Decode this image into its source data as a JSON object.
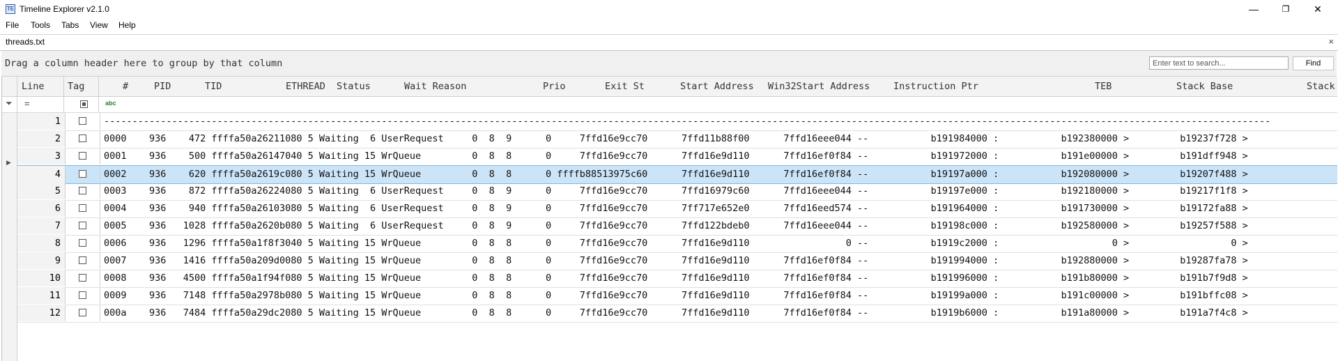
{
  "window": {
    "title": "Timeline Explorer v2.1.0",
    "icon": "app-icon",
    "icon_glyph": "TE"
  },
  "window_controls": {
    "minimize": "—",
    "maximize": "❐",
    "close": "✕"
  },
  "menu": [
    "File",
    "Tools",
    "Tabs",
    "View",
    "Help"
  ],
  "document_tab": {
    "label": "threads.txt",
    "close": "×"
  },
  "group_hint": "Drag a column header here to group by that column",
  "search": {
    "placeholder": "Enter text to search...",
    "value": "",
    "find_label": "Find"
  },
  "columns": [
    "Line",
    "Tag",
    "#",
    "PID",
    "TID",
    "ETHREAD",
    "Status",
    "Wait Reason",
    "Prio",
    "Exit St",
    "Start Address",
    "Win32Start Address",
    "Instruction Ptr",
    "TEB",
    "Stack Base",
    "Stack"
  ],
  "filter_row": {
    "filter_icon": "filter-icon",
    "equals": "=",
    "text_filter": "abc"
  },
  "rows": [
    {
      "line": "1",
      "text": "--------------------------------------------------------------------------------------------------------------------------------------------------------------------------------------------------------------"
    },
    {
      "line": "2",
      "text": "0000    936    472 ffffa50a26211080 5 Waiting  6 UserRequest     0  8  9      0     7ffd16e9cc70      7ffd11b88f00      7ffd16eee044 --           b191984000 :           b192380000 >         b19237f728 >"
    },
    {
      "line": "3",
      "text": "0001    936    500 ffffa50a26147040 5 Waiting 15 WrQueue         0  8  8      0     7ffd16e9cc70      7ffd16e9d110      7ffd16ef0f84 --           b191972000 :           b191e00000 >         b191dff948 >"
    },
    {
      "line": "4",
      "text": "0002    936    620 ffffa50a2619c080 5 Waiting 15 WrQueue         0  8  8      0 ffffb88513975c60      7ffd16e9d110      7ffd16ef0f84 --           b19197a000 :           b192080000 >         b19207f488 >",
      "selected": true
    },
    {
      "line": "5",
      "text": "0003    936    872 ffffa50a26224080 5 Waiting  6 UserRequest     0  8  9      0     7ffd16e9cc70      7ffd16979c60      7ffd16eee044 --           b19197e000 :           b192180000 >         b19217f1f8 >"
    },
    {
      "line": "6",
      "text": "0004    936    940 ffffa50a26103080 5 Waiting  6 UserRequest     0  8  9      0     7ffd16e9cc70      7ff717e652e0      7ffd16eed574 --           b191964000 :           b191730000 >         b19172fa88 >"
    },
    {
      "line": "7",
      "text": "0005    936   1028 ffffa50a2620b080 5 Waiting  6 UserRequest     0  8  9      0     7ffd16e9cc70      7ffd122bdeb0      7ffd16eee044 --           b19198c000 :           b192580000 >         b19257f588 >"
    },
    {
      "line": "8",
      "text": "0006    936   1296 ffffa50a1f8f3040 5 Waiting 15 WrQueue         0  8  8      0     7ffd16e9cc70      7ffd16e9d110                 0 --           b1919c2000 :                    0 >                  0 >"
    },
    {
      "line": "9",
      "text": "0007    936   1416 ffffa50a209d0080 5 Waiting 15 WrQueue         0  8  8      0     7ffd16e9cc70      7ffd16e9d110      7ffd16ef0f84 --           b191994000 :           b192880000 >         b19287fa78 >"
    },
    {
      "line": "10",
      "text": "0008    936   4500 ffffa50a1f94f080 5 Waiting 15 WrQueue         0  8  8      0     7ffd16e9cc70      7ffd16e9d110      7ffd16ef0f84 --           b191996000 :           b191b80000 >         b191b7f9d8 >"
    },
    {
      "line": "11",
      "text": "0009    936   7148 ffffa50a2978b080 5 Waiting 15 WrQueue         0  8  8      0     7ffd16e9cc70      7ffd16e9d110      7ffd16ef0f84 --           b19199a000 :           b191c00000 >         b191bffc08 >"
    },
    {
      "line": "12",
      "text": "000a    936   7484 ffffa50a29dc2080 5 Waiting 15 WrQueue         0  8  8      0     7ffd16e9cc70      7ffd16e9d110      7ffd16ef0f84 --           b1919b6000 :           b191a80000 >         b191a7f4c8 >"
    }
  ]
}
